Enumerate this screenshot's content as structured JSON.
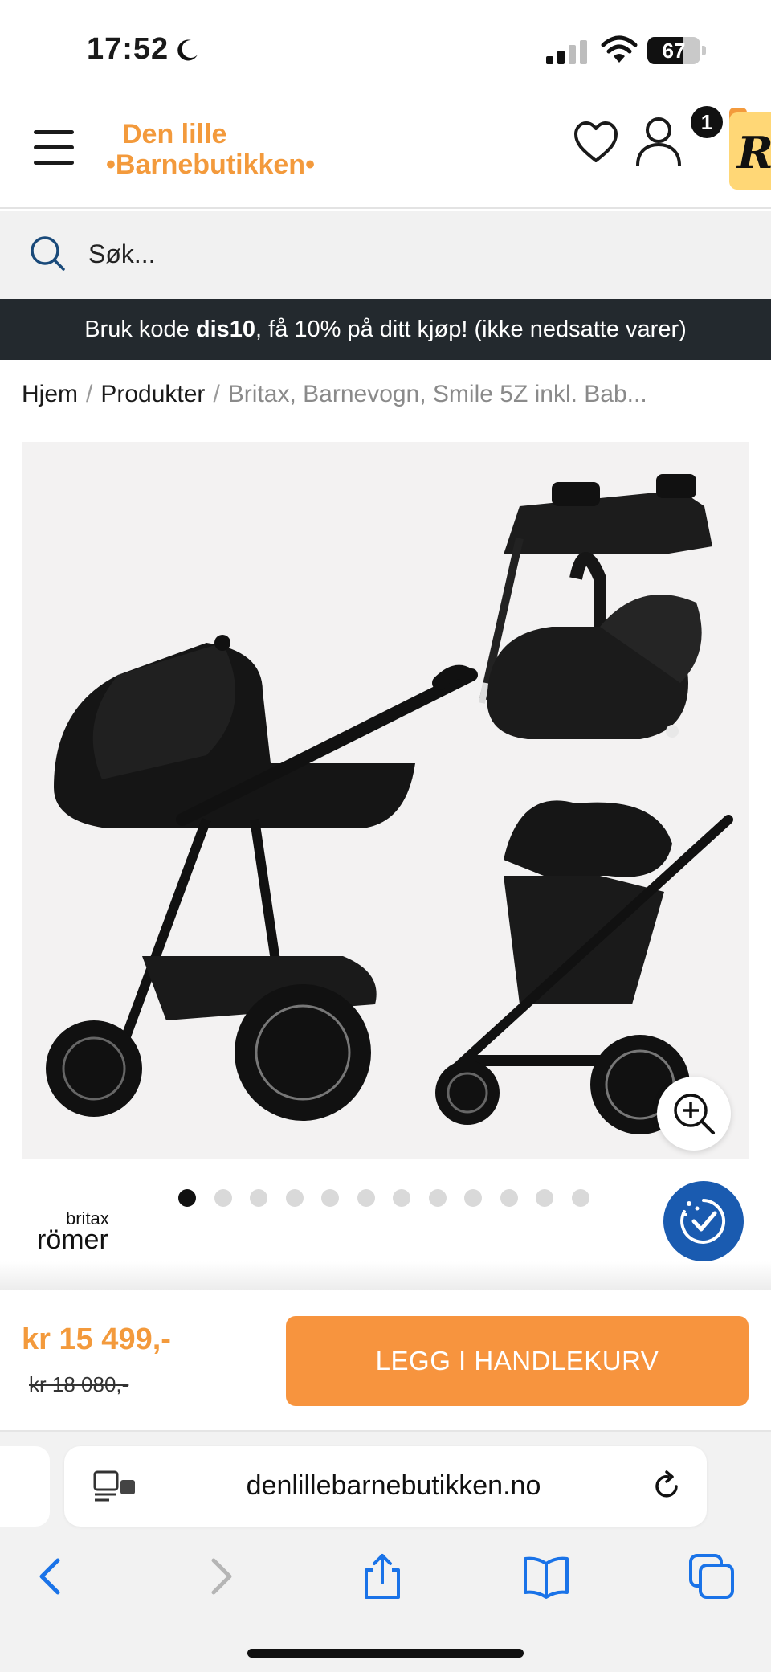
{
  "status_bar": {
    "time": "17:52",
    "battery": "67",
    "battery_level": 0.67
  },
  "header": {
    "logo_line1": "Den lille",
    "logo_line2": "•Barnebutikken•",
    "cart_count": "1",
    "badge_letter": "R"
  },
  "search": {
    "placeholder": "Søk..."
  },
  "promo": {
    "prefix": "Bruk kode ",
    "code": "dis10",
    "suffix": ", få 10% på ditt kjøp! (ikke nedsatte varer)"
  },
  "breadcrumb": {
    "home": "Hjem",
    "products": "Produkter",
    "current": "Britax, Barnevogn, Smile 5Z inkl. Bab..."
  },
  "gallery": {
    "dot_count": 12,
    "active_index": 0
  },
  "brand": {
    "line1": "britax",
    "line2": "römer"
  },
  "product": {
    "price": "kr 15 499,-",
    "old_price": "kr 18 080,-",
    "add_to_cart": "LEGG I HANDLEKURV"
  },
  "browser": {
    "url": "denlillebarnebutikken.no"
  },
  "colors": {
    "brand_orange": "#f39a3c",
    "cta_orange": "#f7943e",
    "promo_bg": "#23292e",
    "a11y_blue": "#1a5bb0"
  }
}
